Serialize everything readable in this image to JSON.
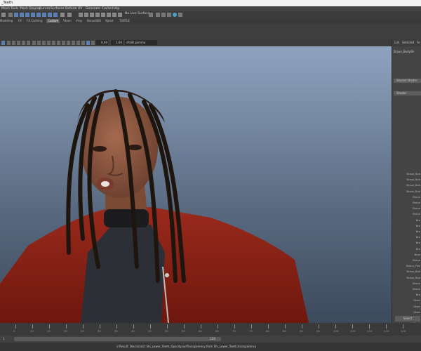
{
  "window": {
    "title": "_Teeth"
  },
  "menubar": {
    "items": [
      "Mesh Tools",
      "Mesh Display",
      "Curves",
      "Surfaces",
      "Deform",
      "UV",
      "Generate",
      "Cache",
      "Help"
    ]
  },
  "status_line": {
    "live_surface": "No Live Surface"
  },
  "shelf": {
    "tabs": [
      "Sculpting",
      "FX",
      "FX Caching",
      "Custom",
      "Arnold",
      "Bifrost",
      "MASH",
      "Motion Graphics",
      "XGen",
      "Rendering",
      "Polygons",
      "TURTLE",
      "Vray"
    ],
    "visible_tabs": [
      "Modeling",
      "FX",
      "FX Caching",
      "Custom",
      "Vtoon",
      "Vray",
      "Bonus600",
      "Xplod",
      "TURTLE"
    ],
    "active": "Custom"
  },
  "viewport_toolbar": {
    "field_a": "0.00",
    "field_b": "1.00",
    "color_space": "sRGB gamma"
  },
  "attribute_editor": {
    "tabs": [
      "List",
      "Selected",
      "Fo"
    ],
    "node": "Braun_BodySh",
    "sections": [
      "Shared Shader",
      "Shader"
    ],
    "items": [
      "Braun_Bod",
      "Braun_Bod",
      "Braun_Bod",
      "Braun_Bod",
      "Braun",
      "Braun",
      "Braun",
      "Braun",
      "Bra",
      "Bra",
      "Bra",
      "Bra",
      "Bra",
      "Bra",
      "Brau",
      "Braun",
      "Braun_Flex",
      "Braun_Bod",
      "Braun_Bod",
      "Braun",
      "Braun",
      "Bra",
      "Oben",
      "Oben",
      "Oben",
      "Oben",
      "Mesh",
      "Mesh",
      "Mesh",
      "Mod",
      "Mod"
    ],
    "select_button": "Select"
  },
  "timeline": {
    "ticks": [
      "5",
      "10",
      "15",
      "20",
      "25",
      "30",
      "35",
      "40",
      "45",
      "50",
      "55",
      "60",
      "65",
      "70",
      "75",
      "80",
      "85",
      "90",
      "95",
      "100",
      "105",
      "110",
      "115",
      "120"
    ]
  },
  "range": {
    "start": "1",
    "end": "120"
  },
  "command_line": {
    "result": "// Result: Disconnect Shi_Lower_Teeth_Opacity.outTransparency from Shi_Lower_Teeth.transparency"
  },
  "colors": {
    "viewport_top": "#8fa3bf",
    "viewport_bottom": "#3d4a5c",
    "jacket": "#8a1f14",
    "skin": "#8a5740"
  }
}
